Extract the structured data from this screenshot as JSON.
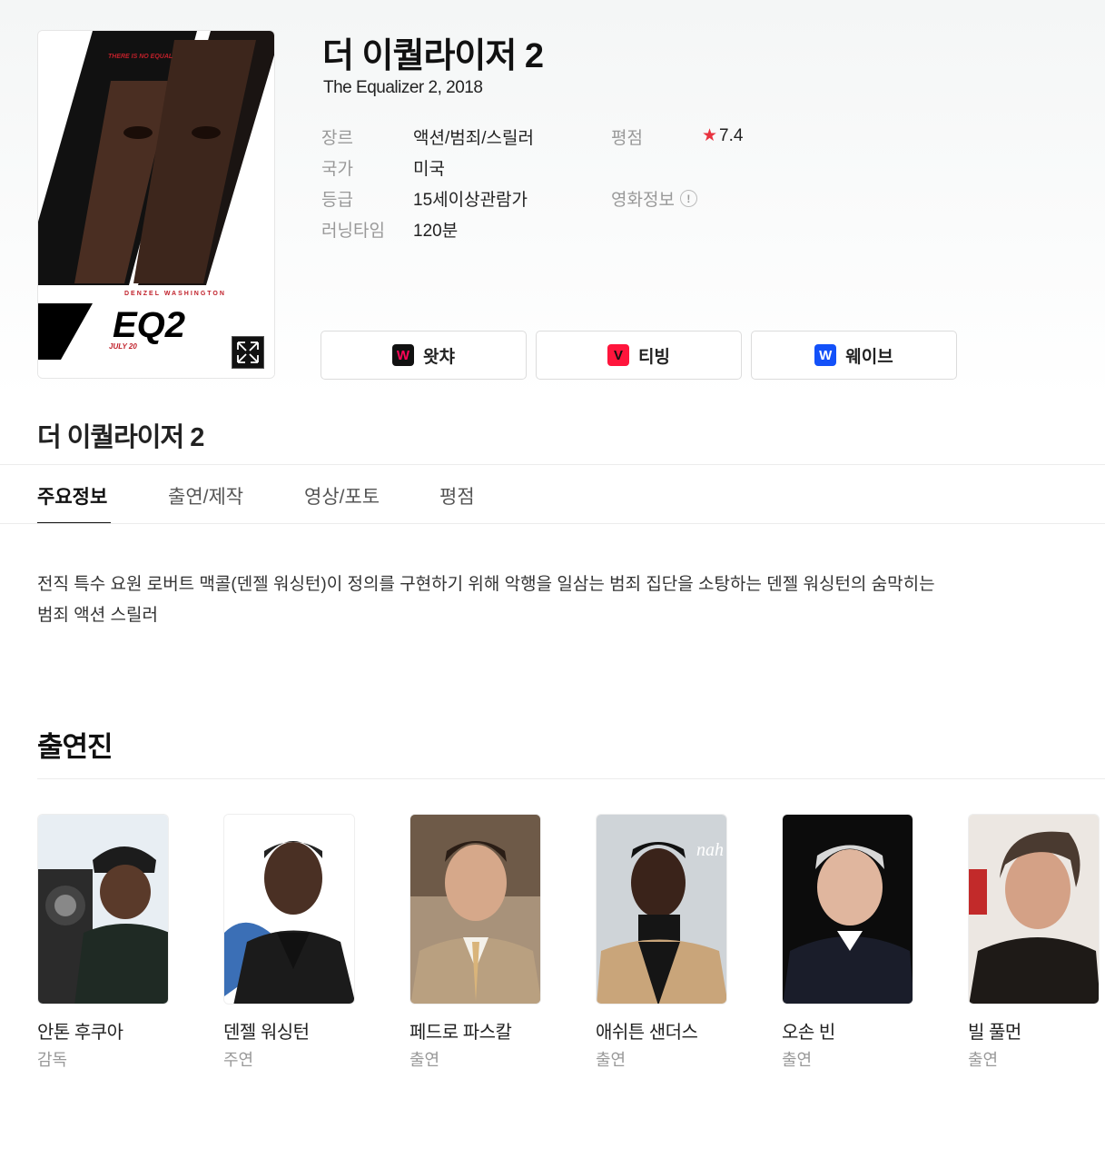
{
  "movie": {
    "title": "더 이퀄라이저 2",
    "subtitle": "The Equalizer 2, 2018"
  },
  "poster": {
    "tagline": "THERE IS NO EQUAL",
    "actor_name": "DENZEL WASHINGTON",
    "logo_text": "EQ2",
    "release": "JULY 20",
    "expand_icon": "expand-icon"
  },
  "info": {
    "genre_label": "장르",
    "genre_value": "액션/범죄/스릴러",
    "country_label": "국가",
    "country_value": "미국",
    "grade_label": "등급",
    "grade_value": "15세이상관람가",
    "runtime_label": "러닝타임",
    "runtime_value": "120분",
    "score_label": "평점",
    "score_value": "7.4",
    "movieinfo_label": "영화정보",
    "star_color": "#e8333f"
  },
  "ott": [
    {
      "label": "왓챠",
      "logo": "W",
      "color": "#ff0558"
    },
    {
      "label": "티빙",
      "logo": "V",
      "color": "#ff153c"
    },
    {
      "label": "웨이브",
      "logo": "W",
      "color": "#1351f9"
    }
  ],
  "section": {
    "title": "더 이퀄라이저 2"
  },
  "tabs": [
    "주요정보",
    "출연/제작",
    "영상/포토",
    "평점"
  ],
  "synopsis": "전직 특수 요원 로버트 맥콜(덴젤 워싱턴)이 정의를 구현하기 위해 악행을 일삼는 범죄 집단을 소탕하는 덴젤 워싱턴의 숨막히는 범죄 액션 스릴러",
  "cast_section": {
    "title": "출연진"
  },
  "cast": [
    {
      "name": "안톤 후쿠아",
      "role": "감독"
    },
    {
      "name": "덴젤 워싱턴",
      "role": "주연"
    },
    {
      "name": "페드로 파스칼",
      "role": "출연"
    },
    {
      "name": "애쉬튼 샌더스",
      "role": "출연"
    },
    {
      "name": "오손 빈",
      "role": "출연"
    },
    {
      "name": "빌 풀먼",
      "role": "출연"
    }
  ]
}
